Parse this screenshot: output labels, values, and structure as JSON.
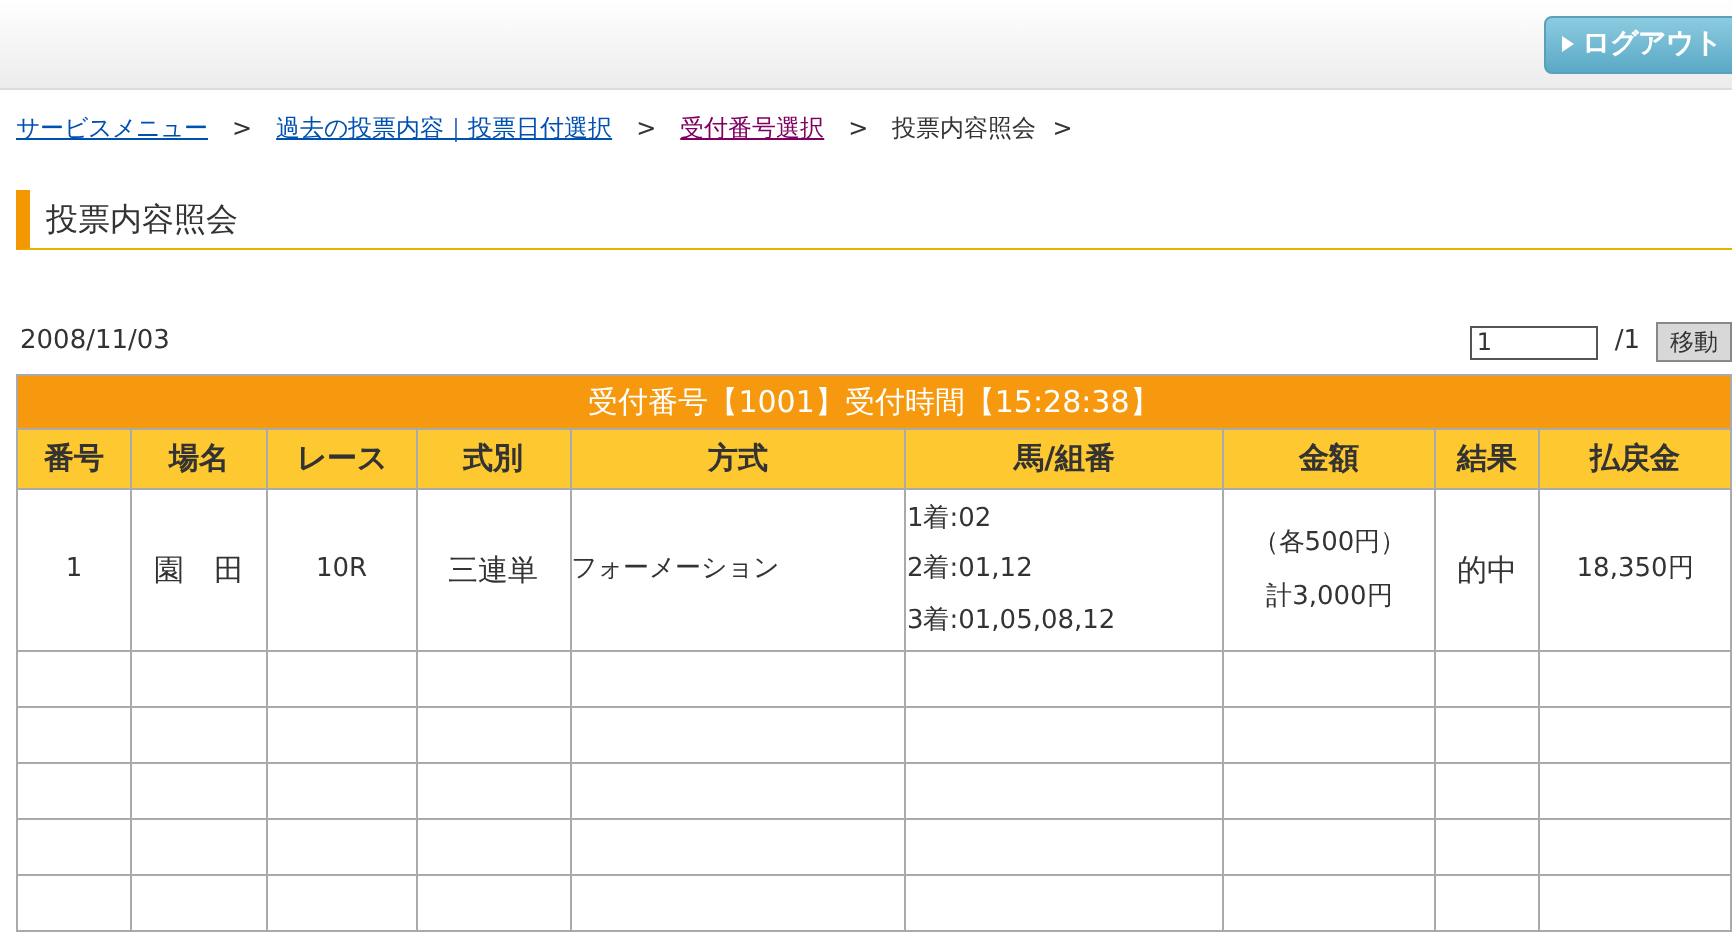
{
  "header": {
    "logout": "ログアウト"
  },
  "breadcrumb": [
    {
      "label": "サービスメニュー",
      "kind": "link"
    },
    {
      "label": "過去の投票内容｜投票日付選択",
      "kind": "link"
    },
    {
      "label": "受付番号選択",
      "kind": "visited_link"
    },
    {
      "label": "投票内容照会",
      "kind": "current"
    }
  ],
  "separator": ">",
  "page_title": "投票内容照会",
  "date": "2008/11/03",
  "pager": {
    "value": "1",
    "total": "/1",
    "button": "移動"
  },
  "table": {
    "caption": "受付番号【1001】受付時間【15:28:38】",
    "columns": [
      "番号",
      "場名",
      "レース",
      "式別",
      "方式",
      "馬/組番",
      "金額",
      "結果",
      "払戻金"
    ],
    "rows": [
      {
        "no": "1",
        "venue": "園　田",
        "race": "10R",
        "type": "三連単",
        "method": "フォーメーション",
        "combos": [
          "1着:02",
          "2着:01,12",
          "3着:01,05,08,12"
        ],
        "amount": [
          "（各500円）",
          "計3,000円"
        ],
        "result": "的中",
        "payout": "18,350円"
      }
    ]
  }
}
